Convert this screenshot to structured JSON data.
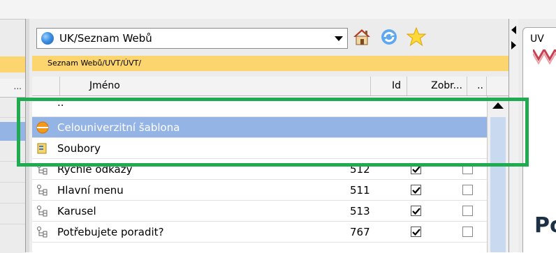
{
  "site_selector": {
    "value": "UK/Seznam Webů"
  },
  "toolbar": {
    "home_icon": "home-icon",
    "refresh_icon": "refresh-icon",
    "favorite_icon": "star-icon"
  },
  "breadcrumb": "Seznam Webů/UVT/ÚVT/",
  "left_panel": {
    "header_ellipsis": "..."
  },
  "table": {
    "columns": {
      "name": "Jméno",
      "id": "Id",
      "shown": "Zobr...",
      "more": ".."
    },
    "rows": [
      {
        "label": "..",
        "id": "",
        "type": "parent",
        "selected": false,
        "shown": null,
        "extra": null
      },
      {
        "label": "Celouniverzitní šablona",
        "id": "",
        "type": "template",
        "selected": true,
        "shown": null,
        "extra": null
      },
      {
        "label": "Soubory",
        "id": "",
        "type": "files",
        "selected": false,
        "shown": null,
        "extra": null
      },
      {
        "label": "Rychlé odkazy",
        "id": "512",
        "type": "tree",
        "selected": false,
        "shown": true,
        "extra": false
      },
      {
        "label": "Hlavní menu",
        "id": "511",
        "type": "tree",
        "selected": false,
        "shown": true,
        "extra": false
      },
      {
        "label": "Karusel",
        "id": "513",
        "type": "tree",
        "selected": false,
        "shown": true,
        "extra": false
      },
      {
        "label": "Potřebujete poradit?",
        "id": "767",
        "type": "tree",
        "selected": false,
        "shown": true,
        "extra": false
      }
    ]
  },
  "right_panel": {
    "tab_label": "UV",
    "title_fragment": "Po"
  },
  "colors": {
    "selection": "#95b4e6",
    "breadcrumb_bar": "#fdd56e",
    "highlight": "#1fab4f"
  }
}
